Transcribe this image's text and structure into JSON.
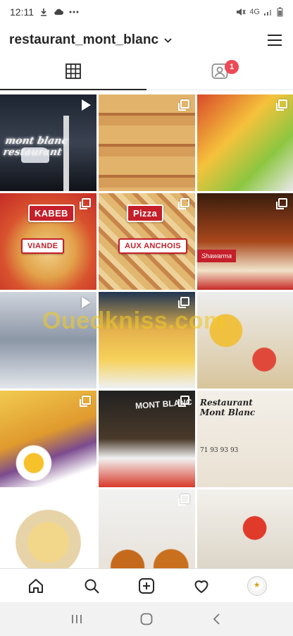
{
  "status_bar": {
    "time": "12:11",
    "network": "4G",
    "icons": [
      "download-icon",
      "cloud-icon",
      "more-dots-icon",
      "mute-icon",
      "signal-icon",
      "battery-icon"
    ]
  },
  "header": {
    "username": "restaurant_mont_blanc",
    "icons": [
      "chevron-down-icon",
      "hamburger-menu-icon"
    ]
  },
  "tabs": {
    "grid_icon": "grid-icon",
    "tagged_icon": "tagged-person-icon",
    "tagged_badge": "1"
  },
  "posts": [
    {
      "kind": "video",
      "sign_text": "mont blanc restaurant"
    },
    {
      "kind": "multi"
    },
    {
      "kind": "multi"
    },
    {
      "kind": "multi",
      "tag_top": "KABEB",
      "tag_bottom": "VIANDE"
    },
    {
      "kind": "multi",
      "tag_top": "Pizza",
      "tag_bottom": "AUX ANCHOIS"
    },
    {
      "kind": "multi",
      "label": "Shawarma"
    },
    {
      "kind": "video"
    },
    {
      "kind": "multi"
    },
    {
      "kind": "image"
    },
    {
      "kind": "multi"
    },
    {
      "kind": "multi",
      "label": "MONT BLANC"
    },
    {
      "kind": "image",
      "brand_line1": "Restaurant",
      "brand_line2": "Mont Blanc",
      "phone": "71 93 93 93"
    },
    {
      "kind": "image"
    },
    {
      "kind": "multi"
    },
    {
      "kind": "image"
    }
  ],
  "watermark": "Ouedkniss.com",
  "bottom_nav": [
    "home-icon",
    "search-icon",
    "new-post-icon",
    "heart-icon",
    "profile-avatar"
  ],
  "system_nav": [
    "recent-apps-icon",
    "home-circle-icon",
    "back-icon"
  ],
  "colors": {
    "badge": "#ed4956",
    "text": "#262626",
    "accent_red": "#c41f2a"
  }
}
